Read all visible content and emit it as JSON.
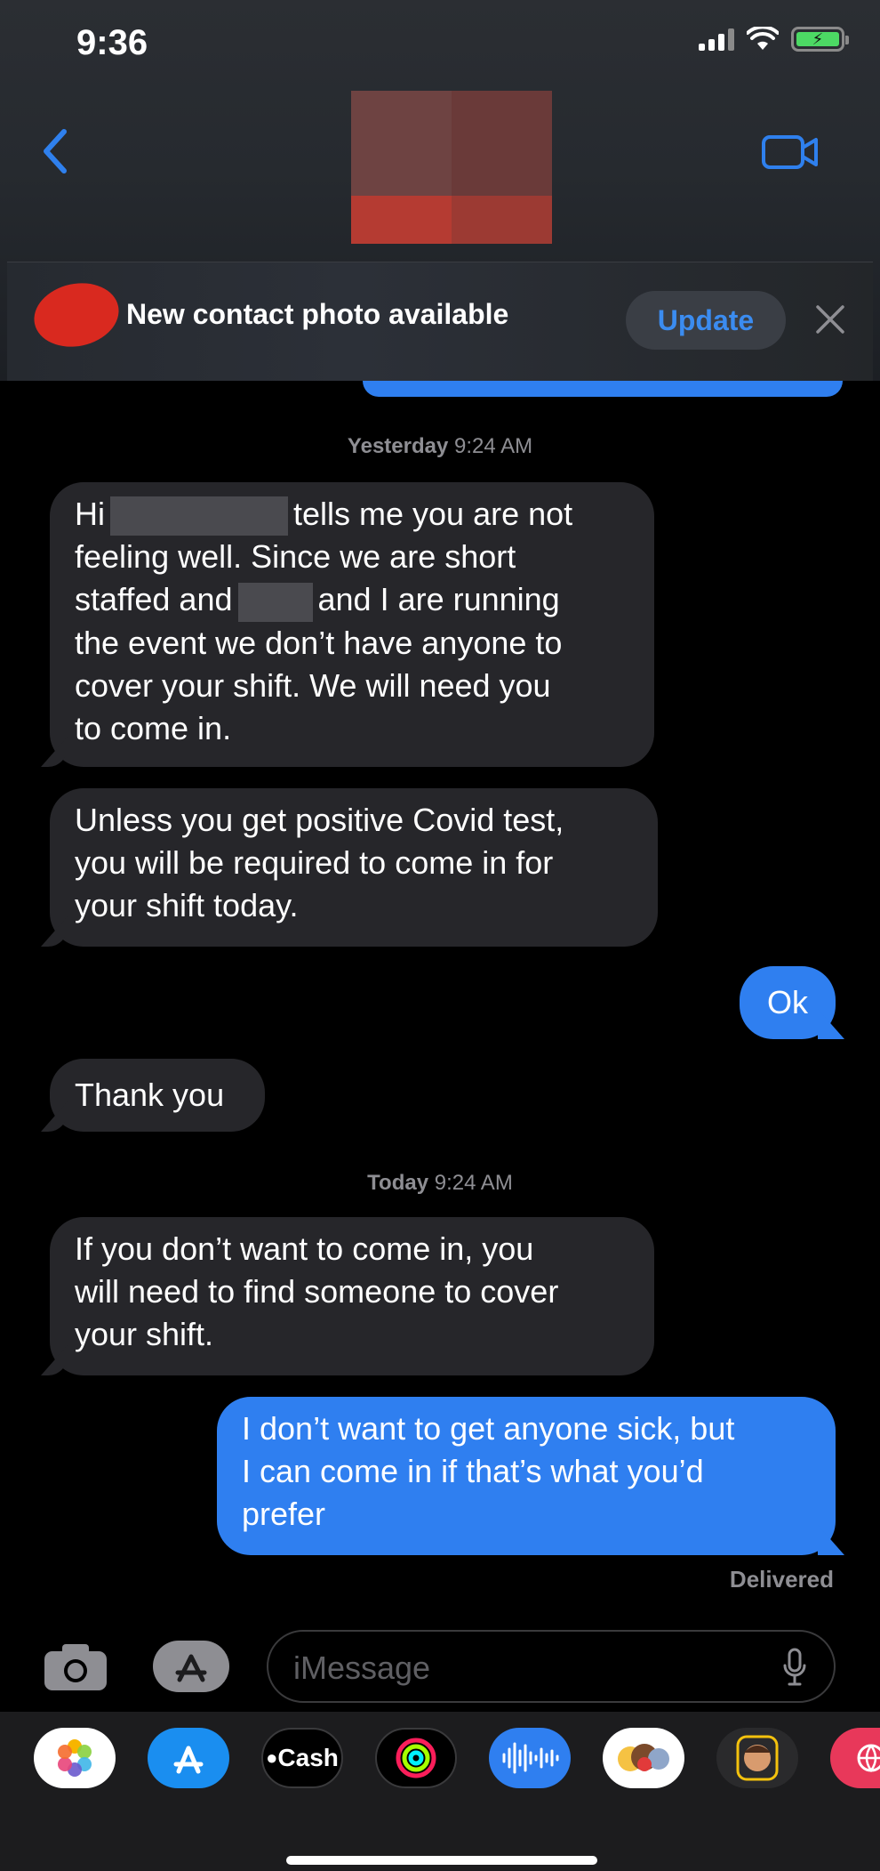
{
  "status_bar": {
    "time": "9:36",
    "battery_charging": true
  },
  "header": {
    "back_label": "",
    "contact_name_hidden": true,
    "video_call": "video-call"
  },
  "banner": {
    "text": "New contact photo available",
    "update_label": "Update"
  },
  "conversation": {
    "timestamps": [
      {
        "day": "Yesterday",
        "time": "9:24 AM"
      },
      {
        "day": "Today",
        "time": "9:24 AM"
      }
    ],
    "messages": [
      {
        "direction": "in",
        "parts": [
          "Hi",
          "tells me you are not",
          "feeling well. Since we are short",
          "staffed and",
          "and I are running",
          "the event we don’t have anyone to",
          "cover your shift. We will need you",
          "to come in."
        ]
      },
      {
        "direction": "in",
        "lines": [
          "Unless you get positive Covid test,",
          "you will be required to come in for",
          "your shift today."
        ]
      },
      {
        "direction": "out",
        "text": "Ok"
      },
      {
        "direction": "in",
        "text": "Thank you"
      },
      {
        "direction": "in",
        "lines": [
          "If you don’t want to come in, you",
          "will need to find someone to cover",
          "your shift."
        ]
      },
      {
        "direction": "out",
        "lines": [
          "I don’t want to get anyone sick, but",
          "I can come in if that’s what you’d",
          "prefer"
        ]
      }
    ],
    "delivery_status": "Delivered"
  },
  "composer": {
    "placeholder": "iMessage"
  },
  "app_strip": {
    "apps": [
      {
        "name": "photos",
        "label": ""
      },
      {
        "name": "app-store",
        "label": ""
      },
      {
        "name": "apple-cash",
        "label": "Cash"
      },
      {
        "name": "activity",
        "label": ""
      },
      {
        "name": "audio-message",
        "label": ""
      },
      {
        "name": "animoji",
        "label": ""
      },
      {
        "name": "memoji",
        "label": ""
      },
      {
        "name": "web-search",
        "label": ""
      }
    ]
  },
  "colors": {
    "bubble_in": "#26262a",
    "bubble_out": "#2f7ff0",
    "accent": "#3b8cf0"
  }
}
